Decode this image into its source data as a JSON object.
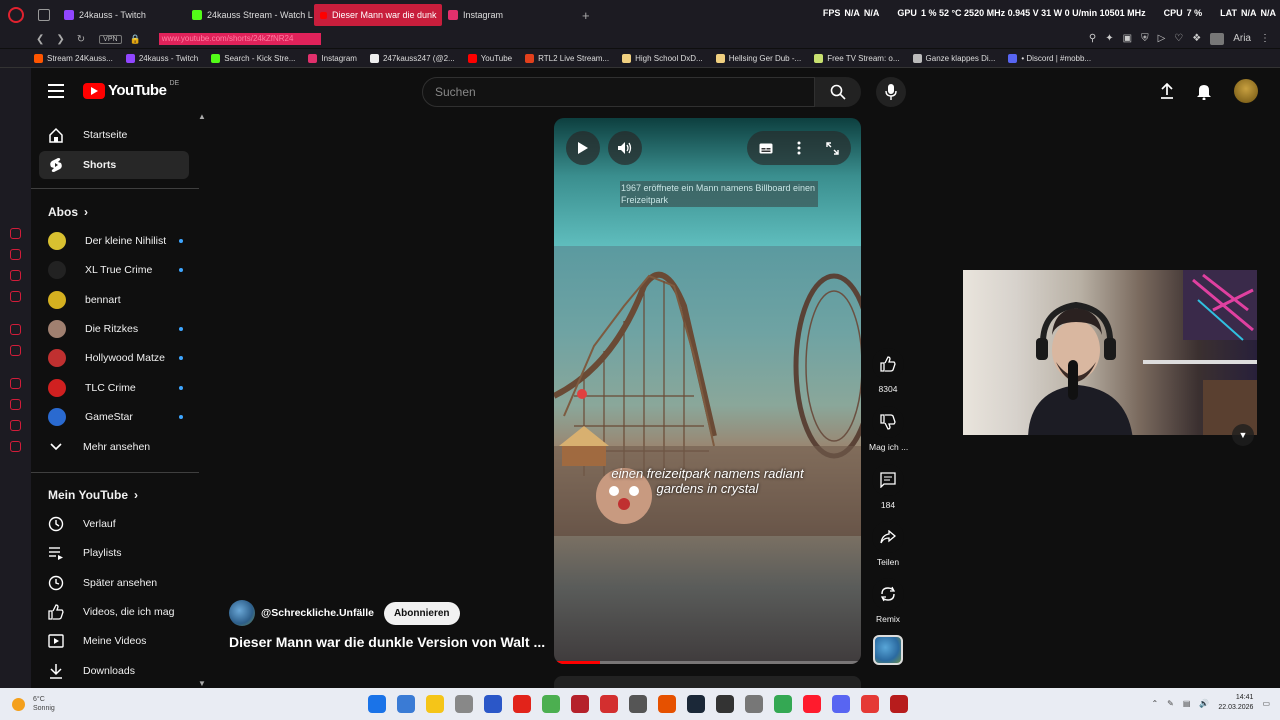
{
  "browser": {
    "tabs": [
      {
        "label": "24kauss - Twitch",
        "color": "#9146ff",
        "active": false
      },
      {
        "label": "24kauss Stream - Watch L",
        "color": "#53fc18",
        "active": false
      },
      {
        "label": "Dieser Mann war die dunk",
        "color": "#ff0000",
        "active": true
      },
      {
        "label": "Instagram",
        "color": "#e1306c",
        "active": false
      }
    ],
    "new_tab": "+",
    "url": "www.youtube.com/shorts/24kZfNR24",
    "vpn": "VPN",
    "stats": {
      "fps_label": "FPS",
      "fps_value": "N/A",
      "fps_value2": "N/A",
      "gpu_label": "GPU",
      "gpu_value": "1 % 52 °C 2520 MHz 0.945 V 31 W 0 U/min 10501 MHz",
      "cpu_label": "CPU",
      "cpu_value": "7 %",
      "lat_label": "LAT",
      "lat_value": "N/A",
      "lat_value2": "N/A"
    },
    "bookmarks": [
      {
        "label": "Stream 24Kauss...",
        "color": "#ff5500"
      },
      {
        "label": "24kauss - Twitch",
        "color": "#9146ff"
      },
      {
        "label": "Search - Kick Stre...",
        "color": "#53fc18"
      },
      {
        "label": "Instagram",
        "color": "#e1306c"
      },
      {
        "label": "247kauss247 (@2...",
        "color": "#eeeeee"
      },
      {
        "label": "YouTube",
        "color": "#ff0000"
      },
      {
        "label": "RTL2 Live Stream...",
        "color": "#e2401c"
      },
      {
        "label": "High School DxD...",
        "color": "#f0d080"
      },
      {
        "label": "Hellsing Ger Dub -...",
        "color": "#f0d080"
      },
      {
        "label": "Free TV Stream: o...",
        "color": "#c8e070"
      },
      {
        "label": "Ganze klappes Di...",
        "color": "#bbbbbb"
      },
      {
        "label": "• Discord | #mobb...",
        "color": "#5865f2"
      }
    ]
  },
  "youtube": {
    "logo": "YouTube",
    "country": "DE",
    "search_placeholder": "Suchen",
    "sidebar": {
      "main": [
        {
          "label": "Startseite",
          "icon": "home-icon"
        },
        {
          "label": "Shorts",
          "icon": "shorts-icon",
          "active": true
        }
      ],
      "subs_heading": "Abos",
      "channels": [
        {
          "label": "Der kleine Nihilist",
          "color": "#d8c030",
          "dot": true
        },
        {
          "label": "XL True Crime",
          "color": "#222222",
          "dot": true
        },
        {
          "label": "bennart",
          "color": "#d4b020",
          "dot": false
        },
        {
          "label": "Die Ritzkes",
          "color": "#a08070",
          "dot": true
        },
        {
          "label": "Hollywood Matze",
          "color": "#c03030",
          "dot": true
        },
        {
          "label": "TLC Crime",
          "color": "#d02020",
          "dot": true
        },
        {
          "label": "GameStar",
          "color": "#2a6ad0",
          "dot": true
        }
      ],
      "more": "Mehr ansehen",
      "you_heading": "Mein YouTube",
      "you_items": [
        {
          "label": "Verlauf",
          "icon": "history-icon"
        },
        {
          "label": "Playlists",
          "icon": "playlists-icon"
        },
        {
          "label": "Später ansehen",
          "icon": "watch-later-icon"
        },
        {
          "label": "Videos, die ich mag",
          "icon": "liked-videos-icon"
        },
        {
          "label": "Meine Videos",
          "icon": "my-videos-icon"
        },
        {
          "label": "Downloads",
          "icon": "downloads-icon"
        }
      ]
    },
    "short": {
      "caption_top": "1967 eröffnete ein Mann namens Billboard einen Freizeitpark",
      "caption_sub": "einen freizeitpark namens radiant gardens in crystal",
      "progress": 0.15,
      "channel": "@Schreckliche.Unfälle",
      "subscribe": "Abonnieren",
      "title": "Dieser Mann war die dunkle Version von Walt ..."
    },
    "actions": {
      "likes": "8304",
      "dislike": "Mag ich ...",
      "comments": "184",
      "share": "Teilen",
      "remix": "Remix"
    }
  },
  "taskbar": {
    "weather_temp": "6°C",
    "weather_desc": "Sonnig",
    "time": "14:41",
    "date": "22.03.2026",
    "apps": [
      "#1a73e8",
      "#3a7bd5",
      "#f5c518",
      "#888888",
      "#2b57c8",
      "#e2231a",
      "#4caf50",
      "#b5212a",
      "#d32f2f",
      "#555555",
      "#e65100",
      "#1b2838",
      "#333333",
      "#777777",
      "#34a853",
      "#ff1b2d",
      "#5865f2",
      "#e53935",
      "#b71c1c"
    ]
  }
}
